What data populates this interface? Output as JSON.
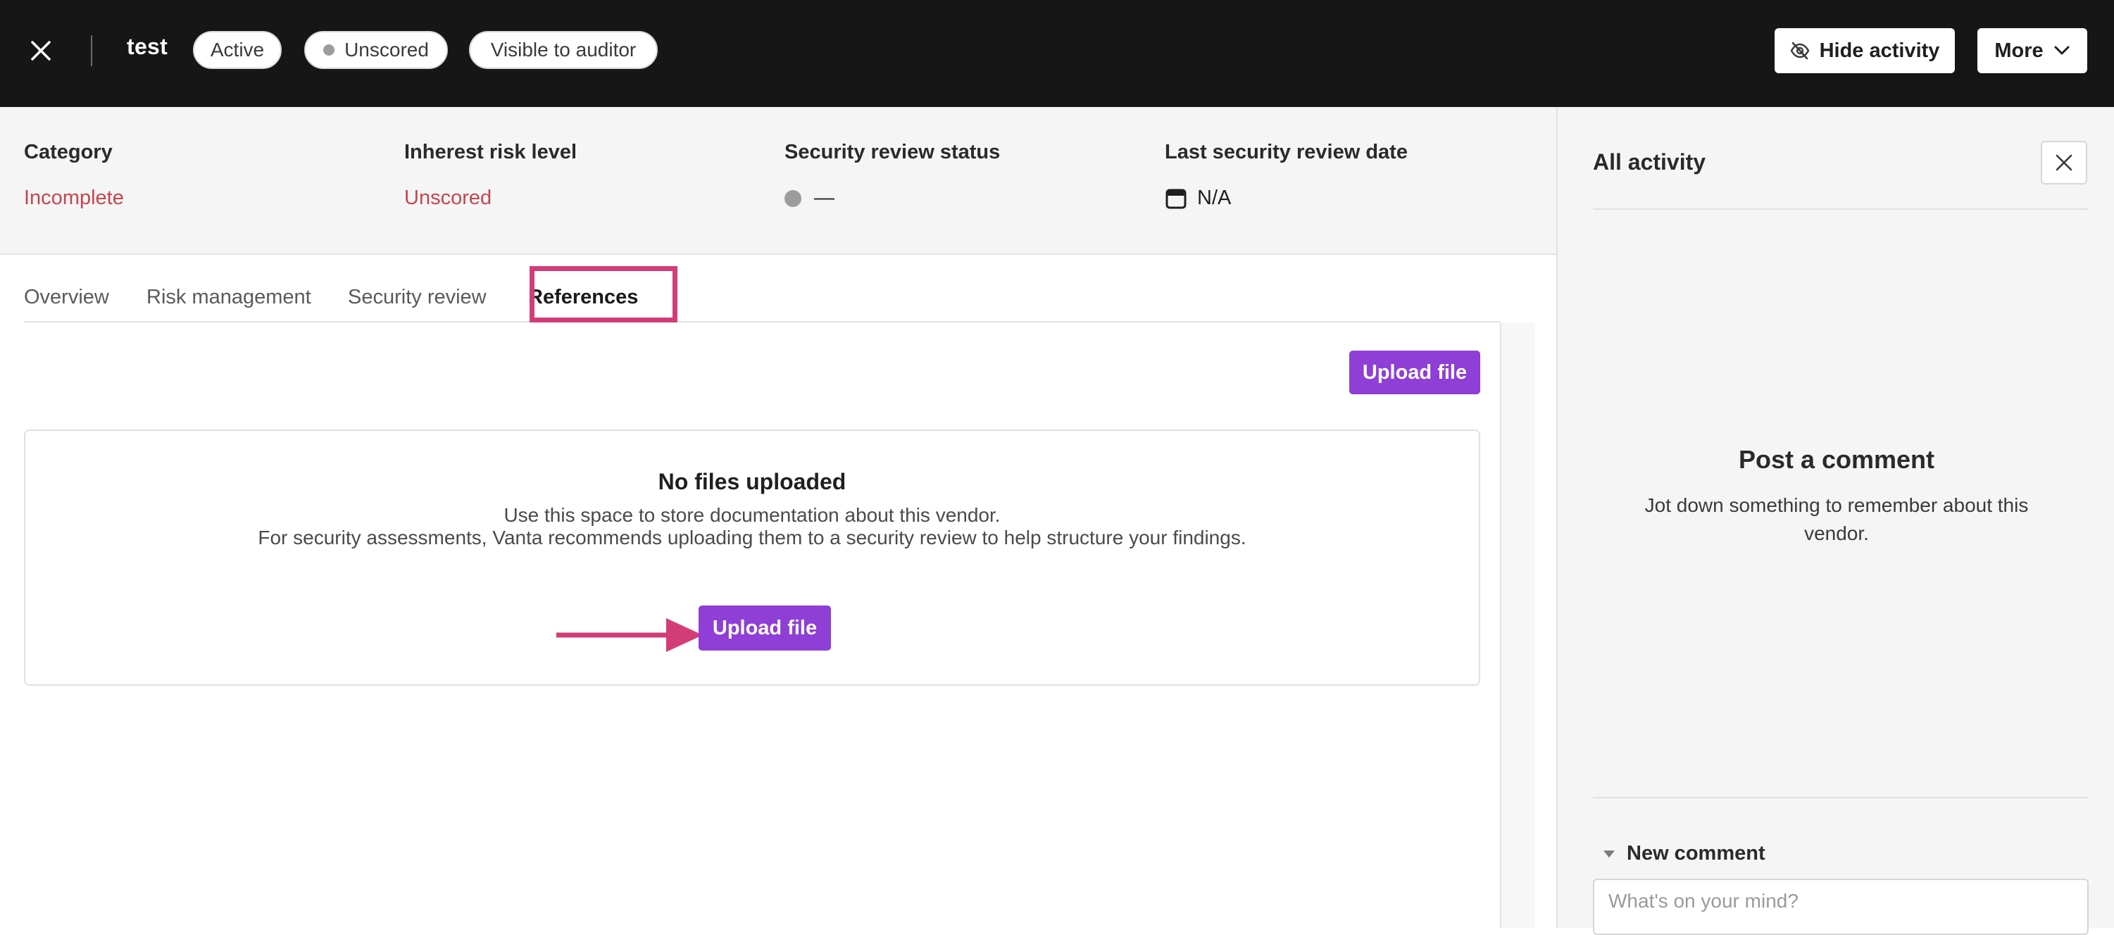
{
  "header": {
    "vendor_name": "test",
    "badges": {
      "active": "Active",
      "unscored": "Unscored",
      "visibility": "Visible to auditor"
    },
    "hide_activity_label": "Hide activity",
    "more_label": "More"
  },
  "meta": {
    "category": {
      "label": "Category",
      "value": "Incomplete"
    },
    "risk": {
      "label": "Inherest risk level",
      "value": "Unscored"
    },
    "review_status": {
      "label": "Security review status",
      "value": "—"
    },
    "review_date": {
      "label": "Last security review date",
      "value": "N/A"
    }
  },
  "tabs": {
    "overview": "Overview",
    "risk_management": "Risk management",
    "security_review": "Security review",
    "references": "References",
    "active": "References"
  },
  "references": {
    "upload_label": "Upload file",
    "empty_title": "No files uploaded",
    "empty_line1": "Use this space to store documentation about this vendor.",
    "empty_line2": "For security assessments, Vanta recommends uploading them to a security review to help structure your findings.",
    "empty_upload_label": "Upload file"
  },
  "activity": {
    "title": "All activity",
    "post_title": "Post a comment",
    "post_desc": "Jot down something to remember about this vendor.",
    "new_comment_label": "New comment",
    "comment_placeholder": "What's on your mind?"
  },
  "colors": {
    "topbar_bg": "#161616",
    "accent_purple": "#8f3ed6",
    "warning_red": "#c4474f",
    "highlight_pink": "#d23d78"
  }
}
